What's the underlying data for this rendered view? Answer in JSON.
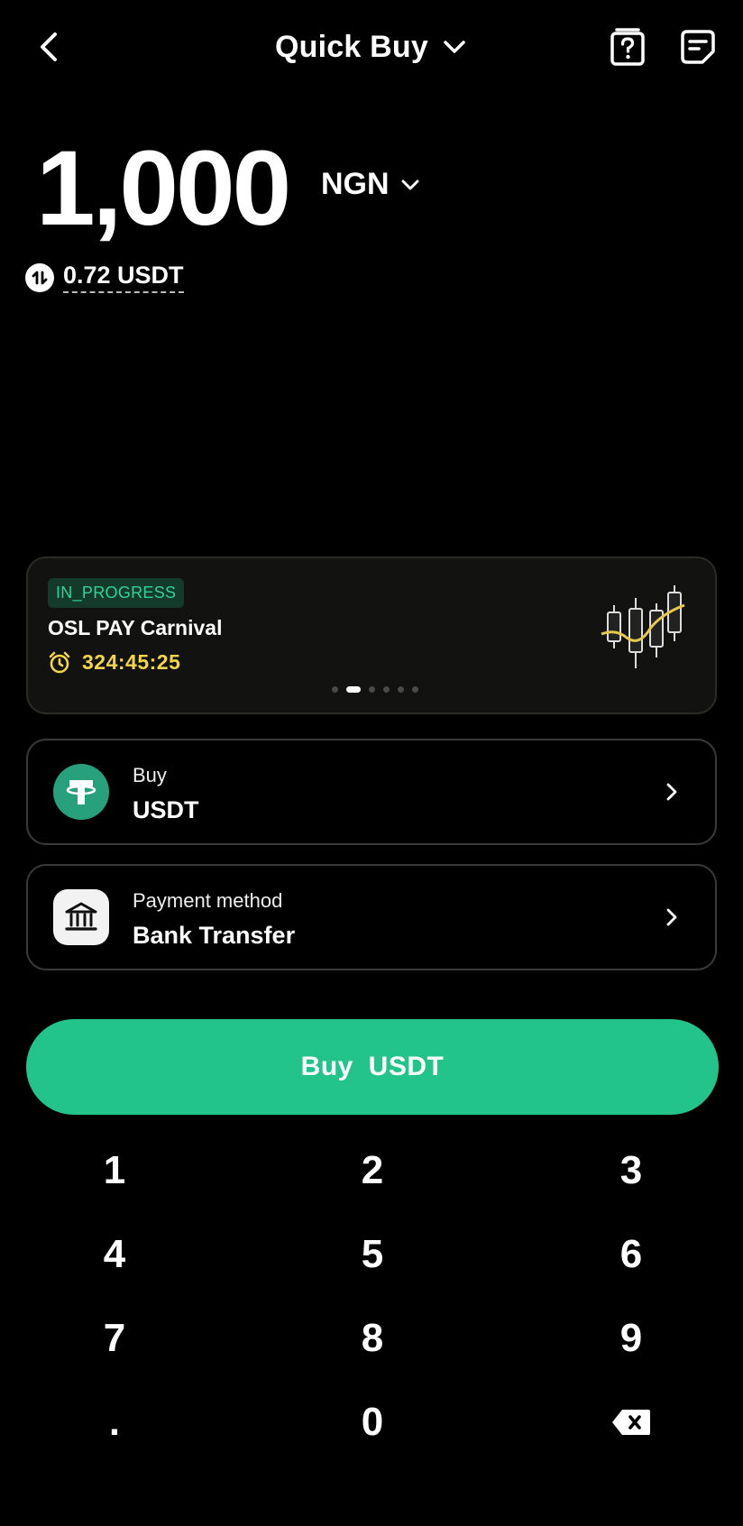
{
  "header": {
    "title": "Quick Buy",
    "icons": [
      "back-icon",
      "chevron-down-icon",
      "help-icon",
      "orders-icon"
    ]
  },
  "amount": {
    "value": "1,000",
    "currency": "NGN",
    "converted": "0.72 USDT"
  },
  "banner": {
    "status": "IN_PROGRESS",
    "title": "OSL PAY Carnival",
    "countdown": "324:45:25",
    "slide_count": 6,
    "active_slide": 2
  },
  "asset_row": {
    "label": "Buy",
    "value": "USDT",
    "icon": "tether-icon"
  },
  "payment_row": {
    "label": "Payment method",
    "value": "Bank Transfer",
    "icon": "bank-icon"
  },
  "buy_button": {
    "label": "Buy  USDT"
  },
  "keypad": {
    "keys": [
      "1",
      "2",
      "3",
      "4",
      "5",
      "6",
      "7",
      "8",
      "9",
      ".",
      "0"
    ],
    "backspace_icon": "backspace-icon"
  },
  "colors": {
    "accent": "#23c38c",
    "badge_text": "#2fd49a",
    "timer": "#f2d64a",
    "background": "#000000"
  }
}
